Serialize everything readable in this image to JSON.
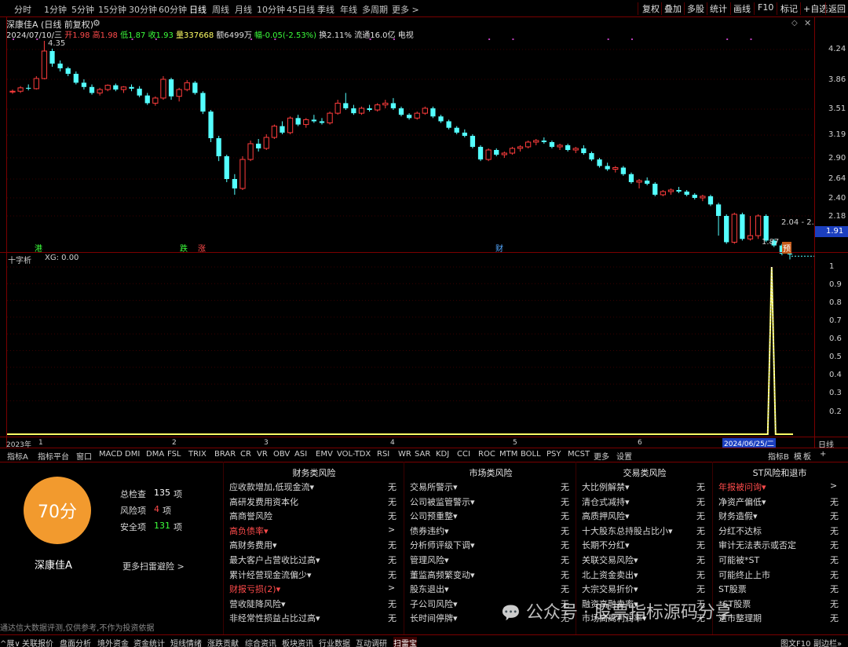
{
  "periods": [
    "分时",
    "1分钟",
    "5分钟",
    "15分钟",
    "30分钟",
    "60分钟",
    "日线",
    "周线",
    "月线",
    "10分钟",
    "45日线",
    "季线",
    "年线",
    "多周期",
    "更多 >"
  ],
  "active_period": "日线",
  "right_buttons": [
    "复权",
    "叠加",
    "多股",
    "统计",
    "画线",
    "F10",
    "标记",
    "+自选",
    "返回"
  ],
  "stock_title": "深康佳A (日线 前复权)",
  "info": {
    "date": "2024/07/10/三",
    "open": "开1.98",
    "high": "高1.98",
    "low": "低1.87",
    "close": "收1.93",
    "volume": "量337668",
    "amount": "额6499万",
    "change": "幅-0.05(-2.53%)",
    "turnover": "换2.11%",
    "float": "流通16.0亿",
    "tag": "电视"
  },
  "price_axis": [
    "4.24",
    "3.86",
    "3.51",
    "3.19",
    "2.90",
    "2.64",
    "2.40",
    "2.18"
  ],
  "last_price": "1.91",
  "annotations": {
    "high": "4.35",
    "low": "1.87",
    "range": "2.04 - 2."
  },
  "markers": [
    "港",
    "跌",
    "涨",
    "财",
    "预"
  ],
  "chart_data": {
    "type": "candlestick",
    "xlabels": [
      "2023年",
      "1",
      "2",
      "3",
      "4",
      "5",
      "6",
      "2024/06/25/二"
    ],
    "price_ticks": [
      4.24,
      3.86,
      3.51,
      3.19,
      2.9,
      2.64,
      2.4,
      2.18
    ],
    "last": 1.91,
    "high_marker": 4.35,
    "low_marker": 1.87,
    "candles": [
      [
        3.72,
        3.74,
        3.69,
        3.72
      ],
      [
        3.72,
        3.78,
        3.7,
        3.76
      ],
      [
        3.76,
        3.8,
        3.73,
        3.75
      ],
      [
        3.75,
        3.9,
        3.74,
        3.87
      ],
      [
        3.87,
        4.35,
        3.86,
        4.22
      ],
      [
        4.22,
        4.25,
        4.02,
        4.06
      ],
      [
        4.06,
        4.1,
        3.96,
        4.0
      ],
      [
        4.0,
        4.02,
        3.9,
        3.93
      ],
      [
        3.93,
        3.96,
        3.8,
        3.82
      ],
      [
        3.82,
        3.86,
        3.74,
        3.77
      ],
      [
        3.77,
        3.8,
        3.68,
        3.7
      ],
      [
        3.7,
        3.76,
        3.67,
        3.74
      ],
      [
        3.74,
        3.8,
        3.72,
        3.79
      ],
      [
        3.79,
        3.81,
        3.72,
        3.74
      ],
      [
        3.74,
        3.78,
        3.7,
        3.77
      ],
      [
        3.77,
        3.8,
        3.72,
        3.75
      ],
      [
        3.75,
        3.78,
        3.65,
        3.67
      ],
      [
        3.67,
        3.7,
        3.56,
        3.58
      ],
      [
        3.58,
        3.66,
        3.55,
        3.64
      ],
      [
        3.64,
        3.9,
        3.62,
        3.86
      ],
      [
        3.86,
        3.88,
        3.62,
        3.66
      ],
      [
        3.66,
        3.76,
        3.6,
        3.74
      ],
      [
        3.74,
        3.85,
        3.72,
        3.82
      ],
      [
        3.82,
        3.84,
        3.68,
        3.7
      ],
      [
        3.7,
        3.72,
        3.45,
        3.48
      ],
      [
        3.48,
        3.5,
        3.1,
        3.15
      ],
      [
        3.15,
        3.18,
        2.86,
        2.92
      ],
      [
        2.92,
        2.94,
        2.6,
        2.64
      ],
      [
        2.64,
        2.7,
        2.44,
        2.52
      ],
      [
        2.52,
        2.92,
        2.5,
        2.88
      ],
      [
        2.88,
        3.12,
        2.86,
        3.08
      ],
      [
        3.08,
        3.14,
        2.98,
        3.02
      ],
      [
        3.02,
        3.2,
        3.0,
        3.16
      ],
      [
        3.16,
        3.32,
        3.14,
        3.3
      ],
      [
        3.3,
        3.36,
        3.2,
        3.22
      ],
      [
        3.22,
        3.42,
        3.2,
        3.4
      ],
      [
        3.4,
        3.44,
        3.3,
        3.32
      ],
      [
        3.32,
        3.4,
        3.28,
        3.38
      ],
      [
        3.38,
        3.44,
        3.34,
        3.36
      ],
      [
        3.36,
        3.4,
        3.32,
        3.34
      ],
      [
        3.34,
        3.48,
        3.32,
        3.46
      ],
      [
        3.46,
        3.62,
        3.44,
        3.58
      ],
      [
        3.58,
        3.7,
        3.5,
        3.52
      ],
      [
        3.52,
        3.56,
        3.44,
        3.46
      ],
      [
        3.46,
        3.54,
        3.44,
        3.52
      ],
      [
        3.52,
        3.56,
        3.48,
        3.5
      ],
      [
        3.5,
        3.58,
        3.48,
        3.56
      ],
      [
        3.56,
        3.62,
        3.52,
        3.58
      ],
      [
        3.58,
        3.64,
        3.5,
        3.52
      ],
      [
        3.52,
        3.54,
        3.42,
        3.44
      ],
      [
        3.44,
        3.46,
        3.38,
        3.4
      ],
      [
        3.4,
        3.48,
        3.38,
        3.46
      ],
      [
        3.46,
        3.54,
        3.44,
        3.52
      ],
      [
        3.52,
        3.54,
        3.4,
        3.42
      ],
      [
        3.42,
        3.44,
        3.34,
        3.36
      ],
      [
        3.36,
        3.38,
        3.26,
        3.28
      ],
      [
        3.28,
        3.3,
        3.2,
        3.22
      ],
      [
        3.22,
        3.26,
        3.16,
        3.18
      ],
      [
        3.18,
        3.2,
        3.02,
        3.04
      ],
      [
        3.04,
        3.06,
        2.86,
        2.88
      ],
      [
        2.88,
        3.02,
        2.86,
        3.0
      ],
      [
        3.0,
        3.02,
        2.92,
        2.94
      ],
      [
        2.94,
        2.98,
        2.9,
        2.96
      ],
      [
        2.96,
        3.04,
        2.94,
        3.02
      ],
      [
        3.02,
        3.06,
        2.98,
        3.04
      ],
      [
        3.04,
        3.12,
        3.02,
        3.1
      ],
      [
        3.1,
        3.14,
        3.06,
        3.12
      ],
      [
        3.12,
        3.16,
        3.08,
        3.1
      ],
      [
        3.1,
        3.12,
        3.02,
        3.04
      ],
      [
        3.04,
        3.08,
        3.0,
        3.06
      ],
      [
        3.06,
        3.08,
        2.98,
        3.0
      ],
      [
        3.0,
        3.04,
        2.96,
        3.02
      ],
      [
        3.02,
        3.06,
        2.94,
        2.96
      ],
      [
        2.96,
        2.98,
        2.86,
        2.88
      ],
      [
        2.88,
        2.9,
        2.78,
        2.8
      ],
      [
        2.8,
        2.84,
        2.74,
        2.76
      ],
      [
        2.76,
        2.8,
        2.72,
        2.78
      ],
      [
        2.78,
        2.8,
        2.68,
        2.7
      ],
      [
        2.7,
        2.72,
        2.58,
        2.6
      ],
      [
        2.6,
        2.64,
        2.52,
        2.62
      ],
      [
        2.62,
        2.66,
        2.56,
        2.58
      ],
      [
        2.58,
        2.6,
        2.42,
        2.44
      ],
      [
        2.44,
        2.5,
        2.42,
        2.48
      ],
      [
        2.48,
        2.52,
        2.44,
        2.5
      ],
      [
        2.5,
        2.54,
        2.46,
        2.48
      ],
      [
        2.48,
        2.5,
        2.42,
        2.44
      ],
      [
        2.44,
        2.46,
        2.38,
        2.4
      ],
      [
        2.4,
        2.44,
        2.36,
        2.42
      ],
      [
        2.42,
        2.44,
        2.3,
        2.32
      ],
      [
        2.32,
        2.34,
        2.16,
        2.18
      ],
      [
        2.18,
        2.2,
        2.06,
        2.08
      ],
      [
        2.08,
        2.22,
        2.06,
        2.2
      ],
      [
        2.2,
        2.22,
        2.1,
        2.12
      ],
      [
        2.12,
        2.18,
        2.1,
        2.16
      ],
      [
        2.16,
        2.2,
        2.12,
        2.18
      ],
      [
        2.18,
        2.2,
        2.08,
        2.1
      ],
      [
        2.1,
        2.12,
        2.02,
        2.04
      ],
      [
        2.04,
        2.06,
        1.92,
        1.94
      ],
      [
        1.94,
        1.98,
        1.87,
        1.93
      ]
    ],
    "indicator": {
      "name": "十字析",
      "label": "XG: 0.00",
      "yticks": [
        1.0,
        0.9,
        0.8,
        0.7,
        0.6,
        0.5,
        0.4,
        0.3,
        0.2
      ],
      "spike_value": 1.0
    }
  },
  "indicator_tabs": [
    "指标A",
    "指标平台",
    "窗口",
    "MACD",
    "DMI",
    "DMA",
    "FSL",
    "TRIX",
    "BRAR",
    "CR",
    "VR",
    "OBV",
    "ASI",
    "EMV",
    "VOL-TDX",
    "RSI",
    "WR",
    "SAR",
    "KDJ",
    "CCI",
    "ROC",
    "MTM",
    "BOLL",
    "PSY",
    "MCST",
    "更多",
    "设置"
  ],
  "indicator_tabs_right": [
    "指标B",
    "模",
    "板",
    "+"
  ],
  "lower_tabs_right": [
    "日线"
  ],
  "score": {
    "value": "70分",
    "total_label": "总检查",
    "total": "135",
    "total_unit": "项",
    "risk_label": "风险项",
    "risk": "4",
    "risk_unit": "项",
    "safe_label": "安全项",
    "safe": "131",
    "safe_unit": "项",
    "name": "深康佳A",
    "more": "更多扫雷避险 >",
    "note": "通达信大数据评测,仅供参考,不作为投资依据"
  },
  "risk_columns": [
    {
      "title": "财务类风险",
      "items": [
        {
          "label": "应收款增加,低现金流▾",
          "value": "无",
          "red": false
        },
        {
          "label": "高研发费用资本化",
          "value": "无",
          "red": false
        },
        {
          "label": "高商誉风险",
          "value": "无",
          "red": false
        },
        {
          "label": "高负债率▾",
          "value": ">",
          "red": true
        },
        {
          "label": "高财务费用▾",
          "value": "无",
          "red": false
        },
        {
          "label": "最大客户占营收比过高▾",
          "value": "无",
          "red": false
        },
        {
          "label": "累计经营现金流偏少▾",
          "value": "无",
          "red": false
        },
        {
          "label": "财报亏损(2)▾",
          "value": ">",
          "red": true
        },
        {
          "label": "营收陡降风险▾",
          "value": "无",
          "red": false
        },
        {
          "label": "非经常性损益占比过高▾",
          "value": "无",
          "red": false
        }
      ]
    },
    {
      "title": "市场类风险",
      "items": [
        {
          "label": "交易所警示▾",
          "value": "无",
          "red": false
        },
        {
          "label": "公司被监管警示▾",
          "value": "无",
          "red": false
        },
        {
          "label": "公司预重整▾",
          "value": "无",
          "red": false
        },
        {
          "label": "债券违约▾",
          "value": "无",
          "red": false
        },
        {
          "label": "分析师评级下调▾",
          "value": "无",
          "red": false
        },
        {
          "label": "管理风险▾",
          "value": "无",
          "red": false
        },
        {
          "label": "董监高频繁变动▾",
          "value": "无",
          "red": false
        },
        {
          "label": "股东退出▾",
          "value": "无",
          "red": false
        },
        {
          "label": "子公司风险▾",
          "value": "无",
          "red": false
        },
        {
          "label": "长时间停牌▾",
          "value": "无",
          "red": false
        }
      ]
    },
    {
      "title": "交易类风险",
      "items": [
        {
          "label": "大比例解禁▾",
          "value": "无",
          "red": false
        },
        {
          "label": "清仓式减持▾",
          "value": "无",
          "red": false
        },
        {
          "label": "高质押风险▾",
          "value": "无",
          "red": false
        },
        {
          "label": "十大股东总持股占比小▾",
          "value": "无",
          "red": false
        },
        {
          "label": "长期不分红▾",
          "value": "无",
          "red": false
        },
        {
          "label": "关联交易风险▾",
          "value": "无",
          "red": false
        },
        {
          "label": "北上资金卖出▾",
          "value": "无",
          "red": false
        },
        {
          "label": "大宗交易折价▾",
          "value": "无",
          "red": false
        },
        {
          "label": "融资高融卖率▾",
          "value": "无",
          "red": false
        },
        {
          "label": "市场高离利润率▾",
          "value": "无",
          "red": false
        }
      ]
    },
    {
      "title": "ST风险和退市",
      "items": [
        {
          "label": "年报被问询▾",
          "value": ">",
          "red": true
        },
        {
          "label": "净资产偏低▾",
          "value": "无",
          "red": false
        },
        {
          "label": "财务造假▾",
          "value": "无",
          "red": false
        },
        {
          "label": "分红不达标",
          "value": "无",
          "red": false
        },
        {
          "label": "审计无法表示或否定",
          "value": "无",
          "red": false
        },
        {
          "label": "可能被*ST",
          "value": "无",
          "red": false
        },
        {
          "label": "可能终止上市",
          "value": "无",
          "red": false
        },
        {
          "label": "ST股票",
          "value": "无",
          "red": false
        },
        {
          "label": "*ST股票",
          "value": "无",
          "red": false
        },
        {
          "label": "退市整理期",
          "value": "无",
          "red": false
        }
      ]
    }
  ],
  "bottom_tabs": [
    "^展∨",
    "关联报价",
    "盘面分析",
    "境外资金",
    "资金统计",
    "短线情绪",
    "涨跌贡献",
    "综合资讯",
    "板块资讯",
    "行业数据",
    "互动调研",
    "扫雷宝"
  ],
  "bottom_tabs_right": [
    "图文F10",
    "副边栏»"
  ],
  "watermark": "公众号 · 股票指标源码分享",
  "colors": {
    "up": "#ff3c3c",
    "down": "#54ffff",
    "axis_red": "#7a0000",
    "indicator": "#ffff66",
    "score_orange": "#f29a2e"
  }
}
